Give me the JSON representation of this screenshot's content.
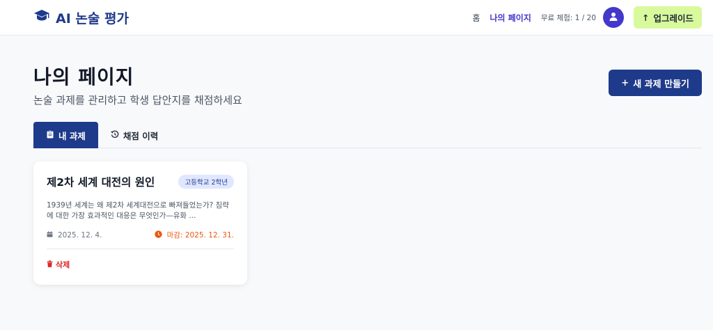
{
  "brand": {
    "name": "AI 논술 평가",
    "icon": "graduation-cap-icon",
    "color": "#1e3a8a"
  },
  "nav": {
    "home": "홈",
    "my_page": "나의 페이지",
    "trial": "무료 체험: 1 / 20",
    "upgrade": "업그레이드"
  },
  "header": {
    "title": "나의 페이지",
    "subtitle": "논술 과제를 관리하고 학생 답안지를 채점하세요",
    "new_button": "새 과제 만들기"
  },
  "tabs": [
    {
      "label": "내 과제",
      "icon": "clipboard-icon",
      "active": true
    },
    {
      "label": "채점 이력",
      "icon": "history-icon",
      "active": false
    }
  ],
  "assignments": [
    {
      "title": "제2차 세계 대전의 원인",
      "grade": "고등학교 2학년",
      "description": "1939년 세계는 왜 제2차 세계대전으로 빠져들었는가? 침략에 대한 가장 효과적인 대응은 무엇인가—유화 ...",
      "created": "2025. 12. 4.",
      "deadline": "마감: 2025. 12. 31.",
      "delete": "삭제"
    }
  ],
  "colors": {
    "primary": "#1e3a8a",
    "accent": "#4338ca",
    "upgrade": "#d9f99d",
    "danger": "#dc2626",
    "warning": "#ea580c"
  }
}
